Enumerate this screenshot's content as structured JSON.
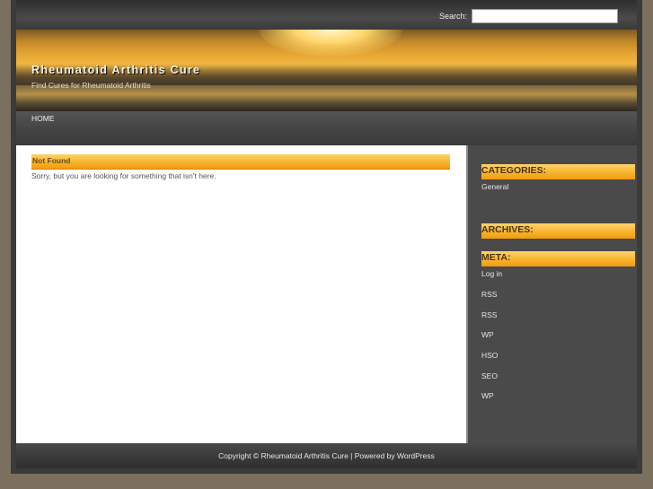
{
  "search": {
    "label": "Search:",
    "value": "",
    "placeholder": ""
  },
  "header": {
    "title": "Rheumatoid Arthritis Cure",
    "tagline": "Find Cures for Rheumatoid Arthritis"
  },
  "nav": {
    "home": "HOME"
  },
  "content": {
    "title": "Not Found",
    "message": "Sorry, but you are looking for something that isn't here."
  },
  "sidebar": {
    "categories": {
      "title": "CATEGORIES:",
      "items": [
        "General"
      ]
    },
    "archives": {
      "title": "ARCHIVES:"
    },
    "meta": {
      "title": "META:",
      "items": [
        "Log in",
        "RSS",
        "RSS",
        "WP",
        "HSO",
        "SEO",
        "WP"
      ]
    }
  },
  "footer": {
    "text": "Copyright © Rheumatoid Arthritis Cure | Powered by WordPress"
  },
  "colors": {
    "accent": "#f6b431",
    "background": "#7b6f5e",
    "panel": "#4a4a4a"
  }
}
